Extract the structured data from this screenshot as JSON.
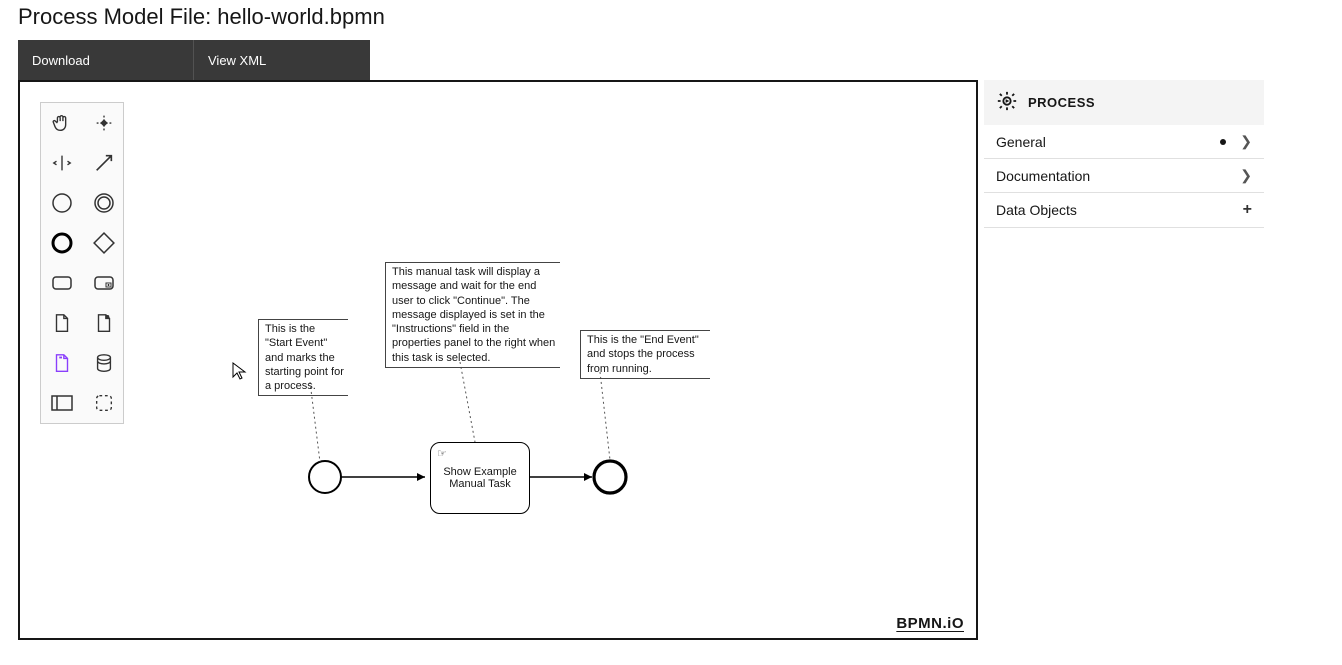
{
  "header": {
    "title": "Process Model File: hello-world.bpmn"
  },
  "tabs": {
    "download": "Download",
    "view_xml": "View XML"
  },
  "palette": {
    "tools": [
      {
        "name": "hand-tool-icon"
      },
      {
        "name": "lasso-tool-icon"
      },
      {
        "name": "space-tool-icon"
      },
      {
        "name": "connection-tool-icon"
      },
      {
        "name": "start-event-icon"
      },
      {
        "name": "intermediate-event-icon"
      },
      {
        "name": "end-event-icon"
      },
      {
        "name": "gateway-icon"
      },
      {
        "name": "task-icon"
      },
      {
        "name": "subprocess-icon"
      },
      {
        "name": "data-object-icon"
      },
      {
        "name": "data-object-ref-icon"
      },
      {
        "name": "data-input-icon"
      },
      {
        "name": "data-store-icon"
      },
      {
        "name": "participant-icon"
      },
      {
        "name": "group-icon"
      }
    ]
  },
  "annotations": {
    "start": "This is the \"Start Event\" and marks the starting point for a process.",
    "task": "This manual task will display a message and wait for the end user to click \"Continue\". The message displayed is set in the \"Instructions\" field in the properties panel to the right when this task is selected.",
    "end": "This is the \"End Event\" and stops the process from running."
  },
  "task_label": "Show Example Manual Task",
  "logo": "BPMN.iO",
  "properties": {
    "header": "PROCESS",
    "items": [
      {
        "label": "General",
        "dot": true,
        "chevron": true
      },
      {
        "label": "Documentation",
        "dot": false,
        "chevron": true
      },
      {
        "label": "Data Objects",
        "plus": true
      }
    ]
  }
}
